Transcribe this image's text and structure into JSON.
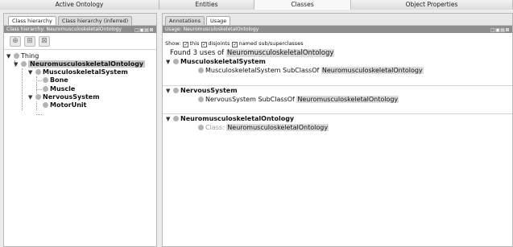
{
  "top_tabs": [
    "Active Ontology",
    "Entities",
    "Classes",
    "Object Properties"
  ],
  "left": {
    "subtabs": [
      "Class hierarchy",
      "Class hierarchy (inferred)"
    ],
    "header": "Class hierarchy: NeuromusculoskeletalOntology",
    "tree": {
      "thing": "Thing",
      "root": "NeuromusculoskeletalOntology",
      "msk": "MusculoskeletalSystem",
      "bone": "Bone",
      "muscle": "Muscle",
      "nervous": "NervousSystem",
      "motor": "MotorUnit"
    }
  },
  "right": {
    "subtabs": [
      "Annotations",
      "Usage"
    ],
    "header": "Usage: NeuromusculoskeletalOntology",
    "show_label": "Show:",
    "show_this": "this",
    "show_disjoints": "disjoints",
    "show_named": "named sub/superclasses",
    "found_prefix": "Found 3 uses of",
    "found_entity": "NeuromusculoskeletalOntology",
    "groups": [
      {
        "title": "MusculoskeletalSystem",
        "axiom_subject": "MusculoskeletalSystem",
        "axiom_kw": "SubClassOf",
        "axiom_object": "NeuromusculoskeletalOntology"
      },
      {
        "title": "NervousSystem",
        "axiom_subject": "NervousSystem",
        "axiom_kw": "SubClassOf",
        "axiom_object": "NeuromusculoskeletalOntology"
      },
      {
        "title": "NeuromusculoskeletalOntology",
        "axiom_kw": "Class:",
        "axiom_object": "NeuromusculoskeletalOntology"
      }
    ]
  },
  "header_controls": "□▣▤⊠",
  "icons": [
    "add-subclass-icon",
    "add-sibling-icon",
    "delete-class-icon"
  ]
}
